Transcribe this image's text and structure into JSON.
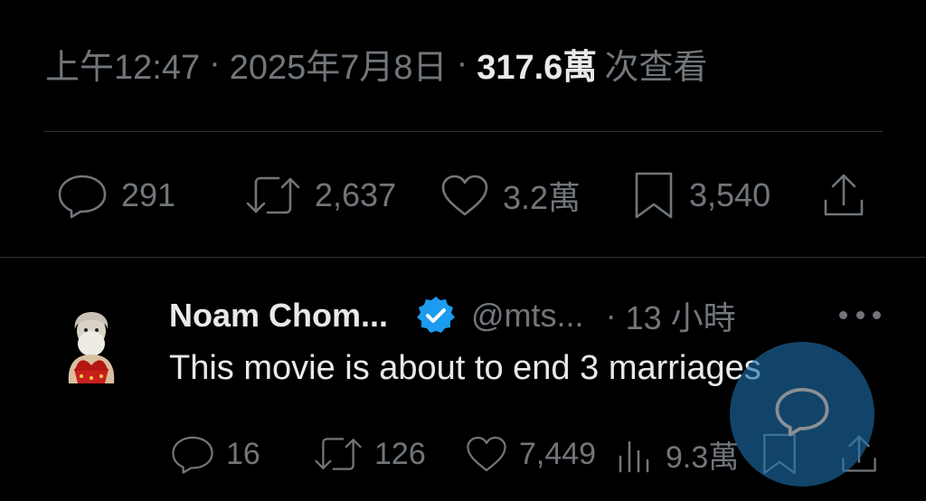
{
  "tweet": {
    "time": "上午12:47",
    "separator": "·",
    "date": "2025年7月8日",
    "views_count": "317.6萬",
    "views_label": "次查看"
  },
  "stats": {
    "replies": "291",
    "reposts": "2,637",
    "likes": "3.2萬",
    "bookmarks": "3,540"
  },
  "reply": {
    "author_name": "Noam Chom...",
    "handle": "@mts...",
    "separator": "·",
    "time": "13 小時",
    "text": "This movie is about to end 3 marriages",
    "stats": {
      "replies": "16",
      "reposts": "126",
      "likes": "7,449",
      "views": "9.3萬"
    }
  },
  "colors": {
    "background": "#000000",
    "text": "#e7e9ea",
    "muted": "#71767b",
    "verified": "#1d9bf0",
    "fab": "#1d6eaa"
  },
  "icons": {
    "reply": "reply-icon",
    "repost": "repost-icon",
    "like": "heart-icon",
    "bookmark": "bookmark-icon",
    "share": "share-icon",
    "views": "views-icon",
    "verified": "verified-badge-icon",
    "more": "more-icon",
    "compose_reply": "compose-reply-icon"
  }
}
